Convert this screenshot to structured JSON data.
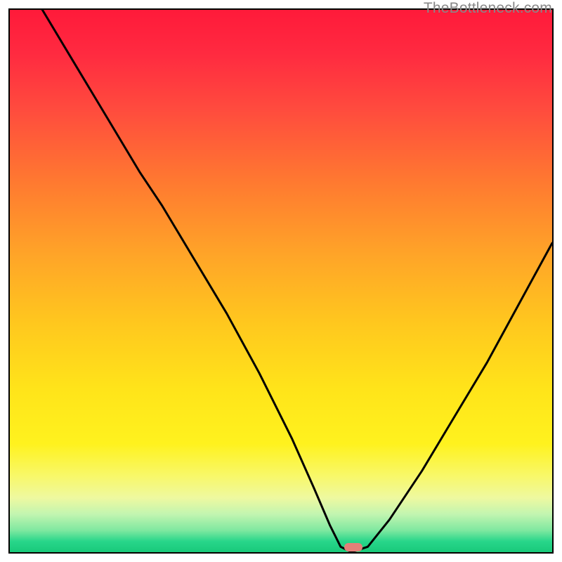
{
  "watermark": "TheBottleneck.com",
  "optimal_marker": {
    "x_fraction": 0.633
  },
  "chart_data": {
    "type": "line",
    "title": "",
    "xlabel": "",
    "ylabel": "",
    "xlim": [
      0,
      100
    ],
    "ylim": [
      0,
      100
    ],
    "series": [
      {
        "name": "bottleneck-curve",
        "x": [
          0,
          6,
          12,
          18,
          24,
          28,
          34,
          40,
          46,
          52,
          56,
          59,
          61,
          63,
          66,
          70,
          76,
          82,
          88,
          94,
          100
        ],
        "values": [
          108,
          100,
          90,
          80,
          70,
          64,
          54,
          44,
          33,
          21,
          12,
          5,
          1,
          0,
          1,
          6,
          15,
          25,
          35,
          46,
          57
        ]
      }
    ],
    "gradient_stops": [
      {
        "pos": 0.0,
        "color": "#ff1a3a"
      },
      {
        "pos": 0.08,
        "color": "#ff2a40"
      },
      {
        "pos": 0.18,
        "color": "#ff4a3e"
      },
      {
        "pos": 0.32,
        "color": "#ff7a30"
      },
      {
        "pos": 0.45,
        "color": "#ffa428"
      },
      {
        "pos": 0.58,
        "color": "#ffc81e"
      },
      {
        "pos": 0.7,
        "color": "#ffe41a"
      },
      {
        "pos": 0.8,
        "color": "#fff21e"
      },
      {
        "pos": 0.86,
        "color": "#f8f86a"
      },
      {
        "pos": 0.9,
        "color": "#eef9a0"
      },
      {
        "pos": 0.93,
        "color": "#c2f5b0"
      },
      {
        "pos": 0.96,
        "color": "#7ee8a0"
      },
      {
        "pos": 0.98,
        "color": "#28d68a"
      },
      {
        "pos": 1.0,
        "color": "#19c97a"
      }
    ]
  }
}
